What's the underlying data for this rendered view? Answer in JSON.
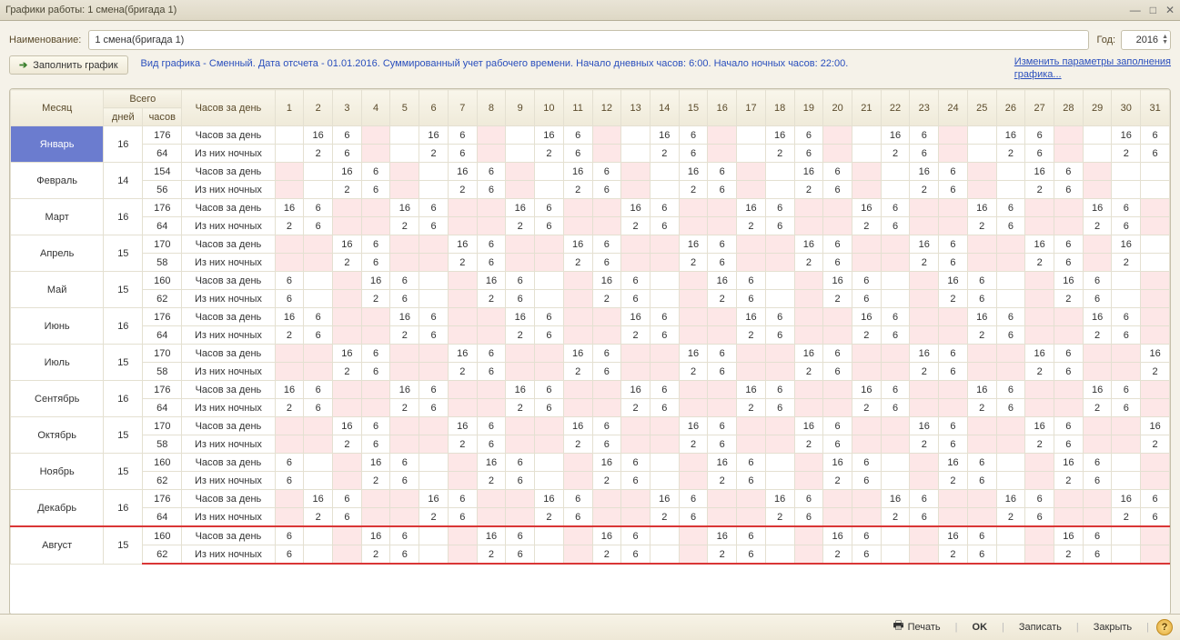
{
  "window": {
    "title": "Графики работы: 1 смена(бригада 1)"
  },
  "fields": {
    "name_label": "Наименование:",
    "name_value": "1 смена(бригада 1)",
    "year_label": "Год:",
    "year_value": "2016"
  },
  "buttons": {
    "fill": "Заполнить график",
    "print": "Печать",
    "ok": "OK",
    "save": "Записать",
    "close": "Закрыть"
  },
  "info_text": "Вид графика - Сменный. Дата отсчета - 01.01.2016. Суммированный учет рабочего времени. Начало дневных часов: 6:00. Начало ночных часов: 22:00.",
  "link": {
    "l1": "Изменить параметры заполнения",
    "l2": "графика..."
  },
  "headers": {
    "month": "Месяц",
    "total": "Всего",
    "days": "дней",
    "hours": "часов",
    "per_day": "Часов за день",
    "metric_day": "Часов за день",
    "metric_night": "Из них ночных"
  },
  "day_nums": [
    "1",
    "2",
    "3",
    "4",
    "5",
    "6",
    "7",
    "8",
    "9",
    "10",
    "11",
    "12",
    "13",
    "14",
    "15",
    "16",
    "17",
    "18",
    "19",
    "20",
    "21",
    "22",
    "23",
    "24",
    "25",
    "26",
    "27",
    "28",
    "29",
    "30",
    "31"
  ],
  "months": [
    {
      "name": "Январь",
      "days": "16",
      "hours": "176",
      "night_hours": "64",
      "selected": true,
      "pattern_start": 0,
      "day": [
        "",
        "16",
        "6",
        "",
        "",
        "16",
        "6",
        "",
        "",
        "16",
        "6",
        "",
        "",
        "16",
        "6",
        "",
        "",
        "16",
        "6",
        "",
        "",
        "16",
        "6",
        "",
        "",
        "16",
        "6",
        "",
        "",
        "16",
        "6"
      ],
      "night": [
        "",
        "2",
        "6",
        "",
        "",
        "2",
        "6",
        "",
        "",
        "2",
        "6",
        "",
        "",
        "2",
        "6",
        "",
        "",
        "2",
        "6",
        "",
        "",
        "2",
        "6",
        "",
        "",
        "2",
        "6",
        "",
        "",
        "2",
        "6"
      ]
    },
    {
      "name": "Февраль",
      "days": "14",
      "hours": "154",
      "night_hours": "56",
      "pattern_start": 1,
      "day": [
        "",
        "",
        "16",
        "6",
        "",
        "",
        "16",
        "6",
        "",
        "",
        "16",
        "6",
        "",
        "",
        "16",
        "6",
        "",
        "",
        "16",
        "6",
        "",
        "",
        "16",
        "6",
        "",
        "",
        "16",
        "6",
        "",
        "",
        ""
      ],
      "night": [
        "",
        "",
        "2",
        "6",
        "",
        "",
        "2",
        "6",
        "",
        "",
        "2",
        "6",
        "",
        "",
        "2",
        "6",
        "",
        "",
        "2",
        "6",
        "",
        "",
        "2",
        "6",
        "",
        "",
        "2",
        "6",
        "",
        "",
        ""
      ]
    },
    {
      "name": "Март",
      "days": "16",
      "hours": "176",
      "night_hours": "64",
      "pattern_start": 0,
      "day": [
        "16",
        "6",
        "",
        "",
        "16",
        "6",
        "",
        "",
        "16",
        "6",
        "",
        "",
        "16",
        "6",
        "",
        "",
        "16",
        "6",
        "",
        "",
        "16",
        "6",
        "",
        "",
        "16",
        "6",
        "",
        "",
        "16",
        "6",
        ""
      ],
      "night": [
        "2",
        "6",
        "",
        "",
        "2",
        "6",
        "",
        "",
        "2",
        "6",
        "",
        "",
        "2",
        "6",
        "",
        "",
        "2",
        "6",
        "",
        "",
        "2",
        "6",
        "",
        "",
        "2",
        "6",
        "",
        "",
        "2",
        "6",
        ""
      ]
    },
    {
      "name": "Апрель",
      "days": "15",
      "hours": "170",
      "night_hours": "58",
      "pattern_start": 2,
      "day": [
        "",
        "",
        "16",
        "6",
        "",
        "",
        "16",
        "6",
        "",
        "",
        "16",
        "6",
        "",
        "",
        "16",
        "6",
        "",
        "",
        "16",
        "6",
        "",
        "",
        "16",
        "6",
        "",
        "",
        "16",
        "6",
        "",
        "16",
        ""
      ],
      "night": [
        "",
        "",
        "2",
        "6",
        "",
        "",
        "2",
        "6",
        "",
        "",
        "2",
        "6",
        "",
        "",
        "2",
        "6",
        "",
        "",
        "2",
        "6",
        "",
        "",
        "2",
        "6",
        "",
        "",
        "2",
        "6",
        "",
        "2",
        ""
      ]
    },
    {
      "name": "Май",
      "days": "15",
      "hours": "160",
      "night_hours": "62",
      "pattern_start": 0,
      "day": [
        "6",
        "",
        "",
        "16",
        "6",
        "",
        "",
        "16",
        "6",
        "",
        "",
        "16",
        "6",
        "",
        "",
        "16",
        "6",
        "",
        "",
        "16",
        "6",
        "",
        "",
        "16",
        "6",
        "",
        "",
        "16",
        "6",
        "",
        ""
      ],
      "night": [
        "6",
        "",
        "",
        "2",
        "6",
        "",
        "",
        "2",
        "6",
        "",
        "",
        "2",
        "6",
        "",
        "",
        "2",
        "6",
        "",
        "",
        "2",
        "6",
        "",
        "",
        "2",
        "6",
        "",
        "",
        "2",
        "6",
        "",
        ""
      ]
    },
    {
      "name": "Июнь",
      "days": "16",
      "hours": "176",
      "night_hours": "64",
      "pattern_start": 0,
      "day": [
        "16",
        "6",
        "",
        "",
        "16",
        "6",
        "",
        "",
        "16",
        "6",
        "",
        "",
        "16",
        "6",
        "",
        "",
        "16",
        "6",
        "",
        "",
        "16",
        "6",
        "",
        "",
        "16",
        "6",
        "",
        "",
        "16",
        "6",
        ""
      ],
      "night": [
        "2",
        "6",
        "",
        "",
        "2",
        "6",
        "",
        "",
        "2",
        "6",
        "",
        "",
        "2",
        "6",
        "",
        "",
        "2",
        "6",
        "",
        "",
        "2",
        "6",
        "",
        "",
        "2",
        "6",
        "",
        "",
        "2",
        "6",
        ""
      ]
    },
    {
      "name": "Июль",
      "days": "15",
      "hours": "170",
      "night_hours": "58",
      "pattern_start": 2,
      "day": [
        "",
        "",
        "16",
        "6",
        "",
        "",
        "16",
        "6",
        "",
        "",
        "16",
        "6",
        "",
        "",
        "16",
        "6",
        "",
        "",
        "16",
        "6",
        "",
        "",
        "16",
        "6",
        "",
        "",
        "16",
        "6",
        "",
        "",
        "16"
      ],
      "night": [
        "",
        "",
        "2",
        "6",
        "",
        "",
        "2",
        "6",
        "",
        "",
        "2",
        "6",
        "",
        "",
        "2",
        "6",
        "",
        "",
        "2",
        "6",
        "",
        "",
        "2",
        "6",
        "",
        "",
        "2",
        "6",
        "",
        "",
        "2"
      ]
    },
    {
      "name": "Август",
      "days": "15",
      "hours": "160",
      "night_hours": "62",
      "highlight": true,
      "pattern_start": 0,
      "day": [
        "6",
        "",
        "",
        "16",
        "6",
        "",
        "",
        "16",
        "6",
        "",
        "",
        "16",
        "6",
        "",
        "",
        "16",
        "6",
        "",
        "",
        "16",
        "6",
        "",
        "",
        "16",
        "6",
        "",
        "",
        "16",
        "6",
        "",
        ""
      ],
      "night": [
        "6",
        "",
        "",
        "2",
        "6",
        "",
        "",
        "2",
        "6",
        "",
        "",
        "2",
        "6",
        "",
        "",
        "2",
        "6",
        "",
        "",
        "2",
        "6",
        "",
        "",
        "2",
        "6",
        "",
        "",
        "2",
        "6",
        "",
        ""
      ]
    },
    {
      "name": "Сентябрь",
      "days": "16",
      "hours": "176",
      "night_hours": "64",
      "pattern_start": 0,
      "day": [
        "16",
        "6",
        "",
        "",
        "16",
        "6",
        "",
        "",
        "16",
        "6",
        "",
        "",
        "16",
        "6",
        "",
        "",
        "16",
        "6",
        "",
        "",
        "16",
        "6",
        "",
        "",
        "16",
        "6",
        "",
        "",
        "16",
        "6",
        ""
      ],
      "night": [
        "2",
        "6",
        "",
        "",
        "2",
        "6",
        "",
        "",
        "2",
        "6",
        "",
        "",
        "2",
        "6",
        "",
        "",
        "2",
        "6",
        "",
        "",
        "2",
        "6",
        "",
        "",
        "2",
        "6",
        "",
        "",
        "2",
        "6",
        ""
      ]
    },
    {
      "name": "Октябрь",
      "days": "15",
      "hours": "170",
      "night_hours": "58",
      "pattern_start": 2,
      "day": [
        "",
        "",
        "16",
        "6",
        "",
        "",
        "16",
        "6",
        "",
        "",
        "16",
        "6",
        "",
        "",
        "16",
        "6",
        "",
        "",
        "16",
        "6",
        "",
        "",
        "16",
        "6",
        "",
        "",
        "16",
        "6",
        "",
        "",
        "16"
      ],
      "night": [
        "",
        "",
        "2",
        "6",
        "",
        "",
        "2",
        "6",
        "",
        "",
        "2",
        "6",
        "",
        "",
        "2",
        "6",
        "",
        "",
        "2",
        "6",
        "",
        "",
        "2",
        "6",
        "",
        "",
        "2",
        "6",
        "",
        "",
        "2"
      ]
    },
    {
      "name": "Ноябрь",
      "days": "15",
      "hours": "160",
      "night_hours": "62",
      "pattern_start": 0,
      "day": [
        "6",
        "",
        "",
        "16",
        "6",
        "",
        "",
        "16",
        "6",
        "",
        "",
        "16",
        "6",
        "",
        "",
        "16",
        "6",
        "",
        "",
        "16",
        "6",
        "",
        "",
        "16",
        "6",
        "",
        "",
        "16",
        "6",
        "",
        ""
      ],
      "night": [
        "6",
        "",
        "",
        "2",
        "6",
        "",
        "",
        "2",
        "6",
        "",
        "",
        "2",
        "6",
        "",
        "",
        "2",
        "6",
        "",
        "",
        "2",
        "6",
        "",
        "",
        "2",
        "6",
        "",
        "",
        "2",
        "6",
        "",
        ""
      ]
    },
    {
      "name": "Декабрь",
      "days": "16",
      "hours": "176",
      "night_hours": "64",
      "pattern_start": 1,
      "day": [
        "",
        "16",
        "6",
        "",
        "",
        "16",
        "6",
        "",
        "",
        "16",
        "6",
        "",
        "",
        "16",
        "6",
        "",
        "",
        "16",
        "6",
        "",
        "",
        "16",
        "6",
        "",
        "",
        "16",
        "6",
        "",
        "",
        "16",
        "6"
      ],
      "night": [
        "",
        "2",
        "6",
        "",
        "",
        "2",
        "6",
        "",
        "",
        "2",
        "6",
        "",
        "",
        "2",
        "6",
        "",
        "",
        "2",
        "6",
        "",
        "",
        "2",
        "6",
        "",
        "",
        "2",
        "6",
        "",
        "",
        "2",
        "6"
      ]
    }
  ]
}
